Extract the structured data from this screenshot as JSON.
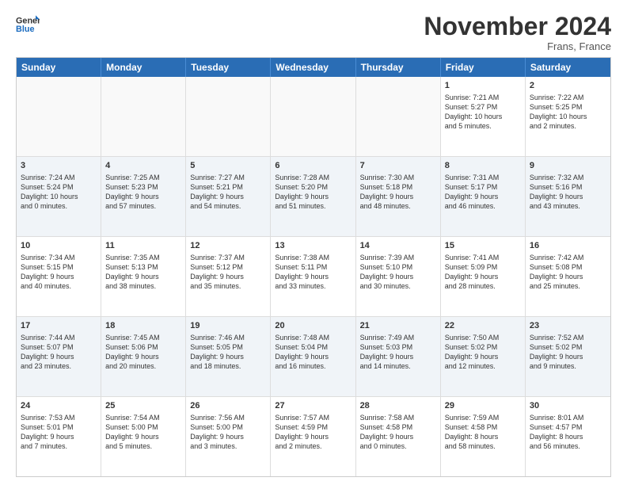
{
  "header": {
    "logo_general": "General",
    "logo_blue": "Blue",
    "month_title": "November 2024",
    "location": "Frans, France"
  },
  "weekdays": [
    "Sunday",
    "Monday",
    "Tuesday",
    "Wednesday",
    "Thursday",
    "Friday",
    "Saturday"
  ],
  "weeks": [
    [
      {
        "day": "",
        "info": ""
      },
      {
        "day": "",
        "info": ""
      },
      {
        "day": "",
        "info": ""
      },
      {
        "day": "",
        "info": ""
      },
      {
        "day": "",
        "info": ""
      },
      {
        "day": "1",
        "info": "Sunrise: 7:21 AM\nSunset: 5:27 PM\nDaylight: 10 hours\nand 5 minutes."
      },
      {
        "day": "2",
        "info": "Sunrise: 7:22 AM\nSunset: 5:25 PM\nDaylight: 10 hours\nand 2 minutes."
      }
    ],
    [
      {
        "day": "3",
        "info": "Sunrise: 7:24 AM\nSunset: 5:24 PM\nDaylight: 10 hours\nand 0 minutes."
      },
      {
        "day": "4",
        "info": "Sunrise: 7:25 AM\nSunset: 5:23 PM\nDaylight: 9 hours\nand 57 minutes."
      },
      {
        "day": "5",
        "info": "Sunrise: 7:27 AM\nSunset: 5:21 PM\nDaylight: 9 hours\nand 54 minutes."
      },
      {
        "day": "6",
        "info": "Sunrise: 7:28 AM\nSunset: 5:20 PM\nDaylight: 9 hours\nand 51 minutes."
      },
      {
        "day": "7",
        "info": "Sunrise: 7:30 AM\nSunset: 5:18 PM\nDaylight: 9 hours\nand 48 minutes."
      },
      {
        "day": "8",
        "info": "Sunrise: 7:31 AM\nSunset: 5:17 PM\nDaylight: 9 hours\nand 46 minutes."
      },
      {
        "day": "9",
        "info": "Sunrise: 7:32 AM\nSunset: 5:16 PM\nDaylight: 9 hours\nand 43 minutes."
      }
    ],
    [
      {
        "day": "10",
        "info": "Sunrise: 7:34 AM\nSunset: 5:15 PM\nDaylight: 9 hours\nand 40 minutes."
      },
      {
        "day": "11",
        "info": "Sunrise: 7:35 AM\nSunset: 5:13 PM\nDaylight: 9 hours\nand 38 minutes."
      },
      {
        "day": "12",
        "info": "Sunrise: 7:37 AM\nSunset: 5:12 PM\nDaylight: 9 hours\nand 35 minutes."
      },
      {
        "day": "13",
        "info": "Sunrise: 7:38 AM\nSunset: 5:11 PM\nDaylight: 9 hours\nand 33 minutes."
      },
      {
        "day": "14",
        "info": "Sunrise: 7:39 AM\nSunset: 5:10 PM\nDaylight: 9 hours\nand 30 minutes."
      },
      {
        "day": "15",
        "info": "Sunrise: 7:41 AM\nSunset: 5:09 PM\nDaylight: 9 hours\nand 28 minutes."
      },
      {
        "day": "16",
        "info": "Sunrise: 7:42 AM\nSunset: 5:08 PM\nDaylight: 9 hours\nand 25 minutes."
      }
    ],
    [
      {
        "day": "17",
        "info": "Sunrise: 7:44 AM\nSunset: 5:07 PM\nDaylight: 9 hours\nand 23 minutes."
      },
      {
        "day": "18",
        "info": "Sunrise: 7:45 AM\nSunset: 5:06 PM\nDaylight: 9 hours\nand 20 minutes."
      },
      {
        "day": "19",
        "info": "Sunrise: 7:46 AM\nSunset: 5:05 PM\nDaylight: 9 hours\nand 18 minutes."
      },
      {
        "day": "20",
        "info": "Sunrise: 7:48 AM\nSunset: 5:04 PM\nDaylight: 9 hours\nand 16 minutes."
      },
      {
        "day": "21",
        "info": "Sunrise: 7:49 AM\nSunset: 5:03 PM\nDaylight: 9 hours\nand 14 minutes."
      },
      {
        "day": "22",
        "info": "Sunrise: 7:50 AM\nSunset: 5:02 PM\nDaylight: 9 hours\nand 12 minutes."
      },
      {
        "day": "23",
        "info": "Sunrise: 7:52 AM\nSunset: 5:02 PM\nDaylight: 9 hours\nand 9 minutes."
      }
    ],
    [
      {
        "day": "24",
        "info": "Sunrise: 7:53 AM\nSunset: 5:01 PM\nDaylight: 9 hours\nand 7 minutes."
      },
      {
        "day": "25",
        "info": "Sunrise: 7:54 AM\nSunset: 5:00 PM\nDaylight: 9 hours\nand 5 minutes."
      },
      {
        "day": "26",
        "info": "Sunrise: 7:56 AM\nSunset: 5:00 PM\nDaylight: 9 hours\nand 3 minutes."
      },
      {
        "day": "27",
        "info": "Sunrise: 7:57 AM\nSunset: 4:59 PM\nDaylight: 9 hours\nand 2 minutes."
      },
      {
        "day": "28",
        "info": "Sunrise: 7:58 AM\nSunset: 4:58 PM\nDaylight: 9 hours\nand 0 minutes."
      },
      {
        "day": "29",
        "info": "Sunrise: 7:59 AM\nSunset: 4:58 PM\nDaylight: 8 hours\nand 58 minutes."
      },
      {
        "day": "30",
        "info": "Sunrise: 8:01 AM\nSunset: 4:57 PM\nDaylight: 8 hours\nand 56 minutes."
      }
    ]
  ]
}
